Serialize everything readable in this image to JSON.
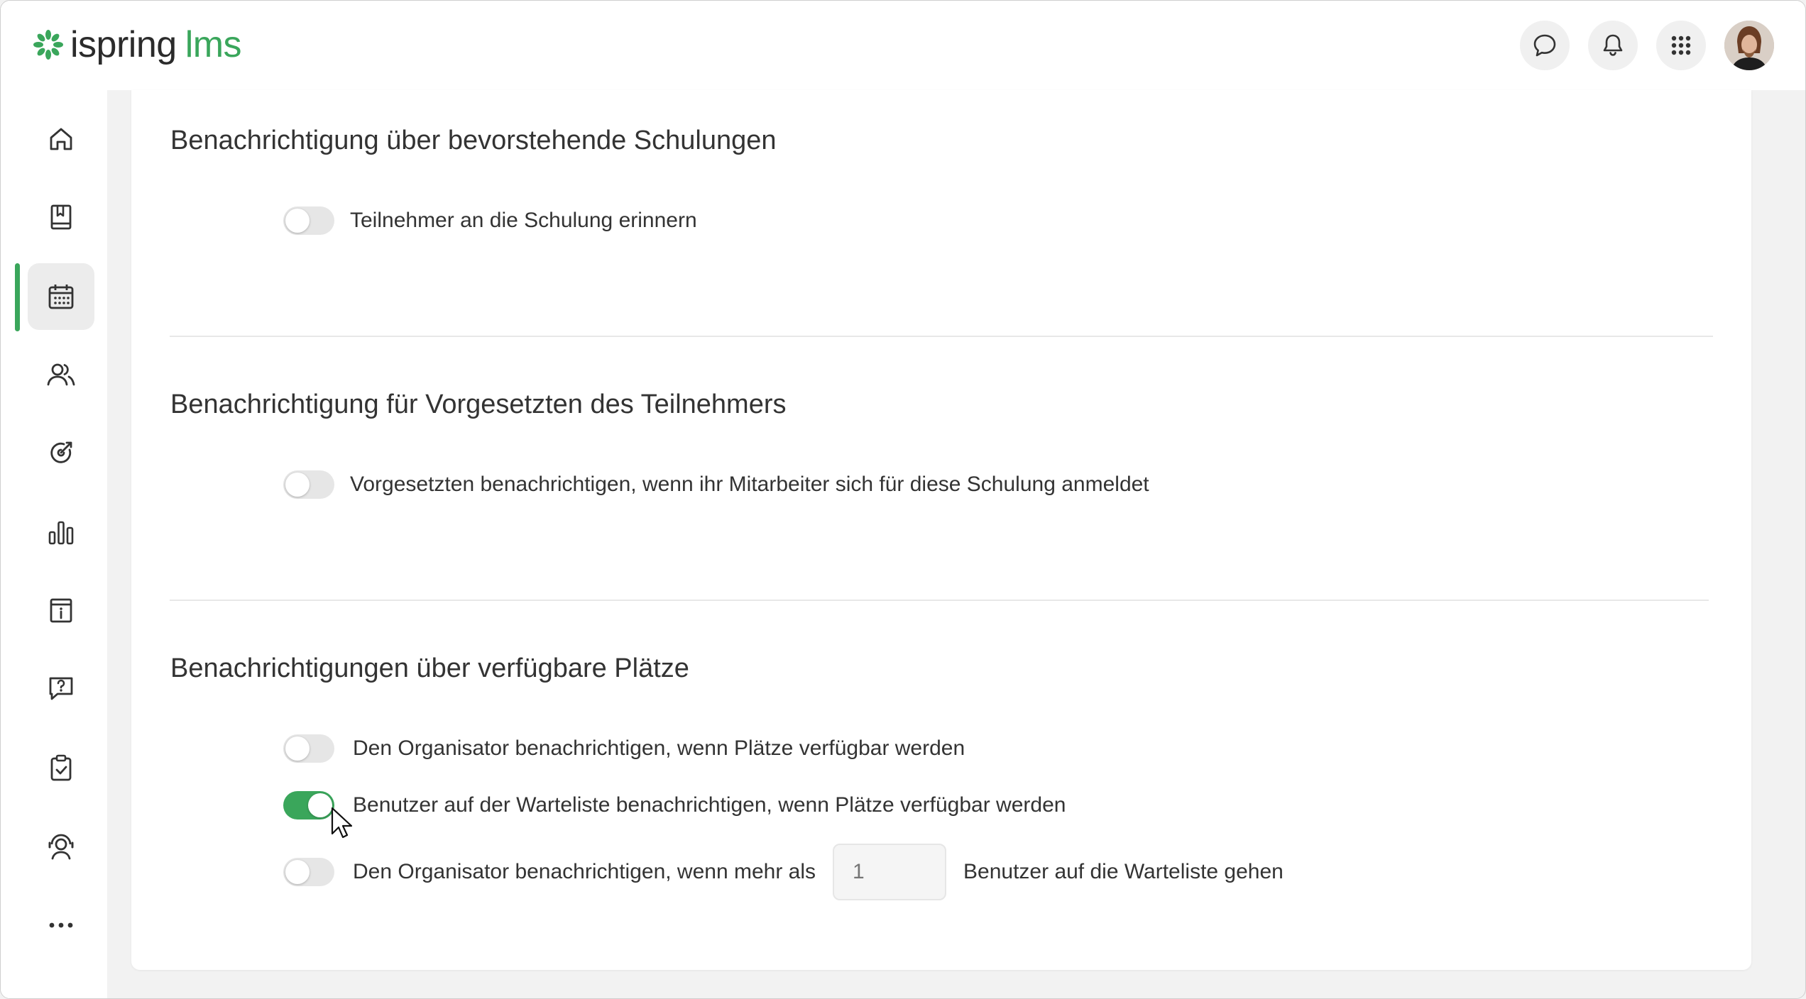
{
  "app": {
    "logo_word1": "ispring",
    "logo_word2": "lms",
    "brand_color": "#3aa65b"
  },
  "header": {
    "icons": [
      "chat-bubble-icon",
      "bell-icon",
      "apps-grid-icon"
    ],
    "avatar": "user-avatar"
  },
  "sidebar": {
    "items": [
      {
        "icon": "home-icon",
        "active": false
      },
      {
        "icon": "book-icon",
        "active": false
      },
      {
        "icon": "calendar-icon",
        "active": true
      },
      {
        "icon": "users-icon",
        "active": false
      },
      {
        "icon": "target-icon",
        "active": false
      },
      {
        "icon": "bar-chart-icon",
        "active": false
      },
      {
        "icon": "info-calendar-icon",
        "active": false
      },
      {
        "icon": "question-chat-icon",
        "active": false
      },
      {
        "icon": "clipboard-check-icon",
        "active": false
      },
      {
        "icon": "user-support-icon",
        "active": false
      },
      {
        "icon": "more-icon",
        "active": false
      }
    ]
  },
  "sections": [
    {
      "title": "Benachrichtigung über bevorstehende Schulungen",
      "options": [
        {
          "label": "Teilnehmer an die Schulung erinnern",
          "enabled": false
        }
      ]
    },
    {
      "title": "Benachrichtigung für Vorgesetzten des Teilnehmers",
      "options": [
        {
          "label": "Vorgesetzten benachrichtigen, wenn ihr Mitarbeiter sich für diese Schulung anmeldet",
          "enabled": false
        }
      ]
    },
    {
      "title": "Benachrichtigungen über verfügbare Plätze",
      "options": [
        {
          "label": "Den Organisator benachrichtigen, wenn Plätze verfügbar werden",
          "enabled": false
        },
        {
          "label": "Benutzer auf der Warteliste benachrichtigen, wenn Plätze verfügbar werden",
          "enabled": true
        },
        {
          "label_before": "Den Organisator benachrichtigen, wenn mehr als",
          "input_placeholder": "1",
          "label_after": "Benutzer auf die Warteliste gehen",
          "enabled": false
        }
      ]
    }
  ]
}
